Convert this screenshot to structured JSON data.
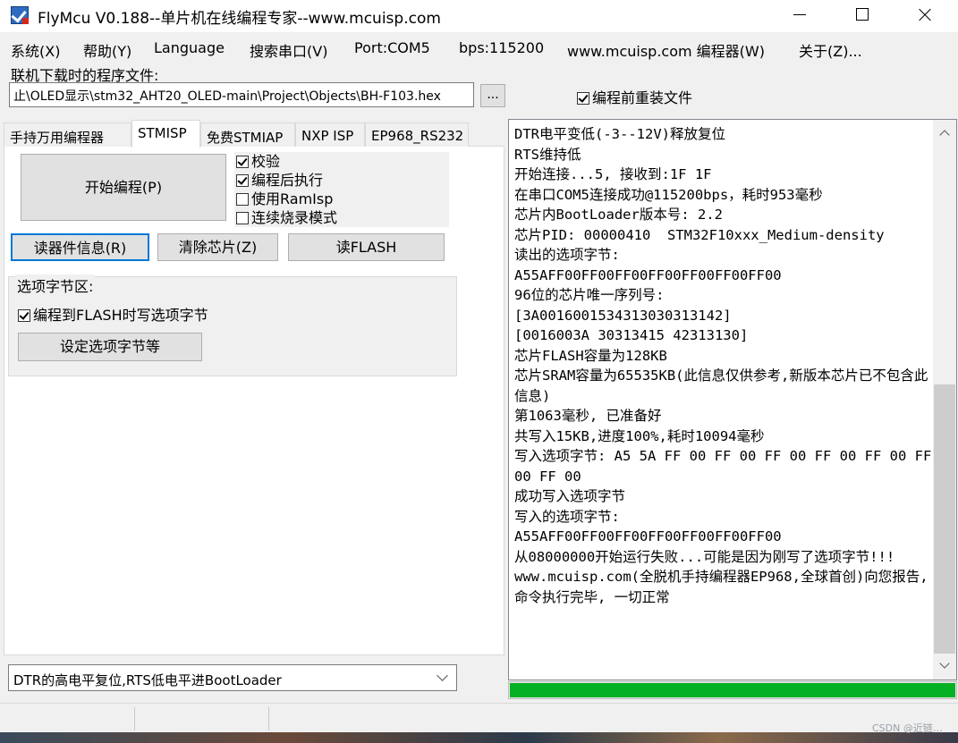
{
  "window": {
    "title": "FlyMcu V0.188--单片机在线编程专家--www.mcuisp.com",
    "icon": "flymcu-app-icon",
    "controls": [
      "minimize-icon",
      "maximize-icon",
      "close-icon"
    ]
  },
  "menu": {
    "items": [
      "系统(X)",
      "帮助(Y)",
      "Language",
      "搜索串口(V)",
      "Port:COM5",
      "bps:115200",
      "www.mcuisp.com 编程器(W)",
      "关于(Z)..."
    ]
  },
  "file": {
    "label": "联机下载时的程序文件:",
    "path": "止\\OLED显示\\stm32_AHT20_OLED-main\\Project\\Objects\\BH-F103.hex",
    "browse_label": "...",
    "reload_label": "编程前重装文件",
    "reload_checked": true
  },
  "tabs": [
    "手持万用编程器",
    "STMISP",
    "免费STMIAP",
    "NXP ISP",
    "EP968_RS232"
  ],
  "active_tab": "STMISP",
  "stmisp": {
    "start_button": "开始编程(P)",
    "checks": [
      {
        "label": "校验",
        "checked": true
      },
      {
        "label": "编程后执行",
        "checked": true
      },
      {
        "label": "使用RamIsp",
        "checked": false
      },
      {
        "label": "连续烧录模式",
        "checked": false
      }
    ],
    "device_info_button": "读器件信息(R)",
    "erase_button": "清除芯片(Z)",
    "read_flash_button": "读FLASH",
    "option_group_label": "选项字节区:",
    "write_option_label": "编程到FLASH时写选项字节",
    "write_option_checked": true,
    "set_option_button": "设定选项字节等"
  },
  "mode_select": {
    "value": "DTR的高电平复位,RTS低电平进BootLoader"
  },
  "log": {
    "lines": [
      "DTR电平变低(-3--12V)释放复位",
      "RTS维持低",
      "开始连接...5, 接收到:1F 1F",
      "在串口COM5连接成功@115200bps，耗时953毫秒",
      "芯片内BootLoader版本号: 2.2",
      "芯片PID: 00000410  STM32F10xxx_Medium-density",
      "读出的选项字节:",
      "A55AFF00FF00FF00FF00FF00FF00FF00",
      "96位的芯片唯一序列号:",
      "[3A0016001534313030313142]",
      "[0016003A 30313415 42313130]",
      "芯片FLASH容量为128KB",
      "芯片SRAM容量为65535KB(此信息仅供参考,新版本芯片已不包含此信息)",
      "第1063毫秒, 已准备好",
      "共写入15KB,进度100%,耗时10094毫秒",
      "写入选项字节: A5 5A FF 00 FF 00 FF 00 FF 00 FF 00 FF 00 FF 00",
      "成功写入选项字节",
      "写入的选项字节:",
      "A55AFF00FF00FF00FF00FF00FF00FF00",
      "从08000000开始运行失败...可能是因为刚写了选项字节!!!",
      "www.mcuisp.com(全脱机手持编程器EP968,全球首创)向您报告, 命令执行完毕, 一切正常"
    ]
  },
  "progress": {
    "percent": 100,
    "color": "#06b025"
  },
  "watermark": "CSDN @近链…"
}
